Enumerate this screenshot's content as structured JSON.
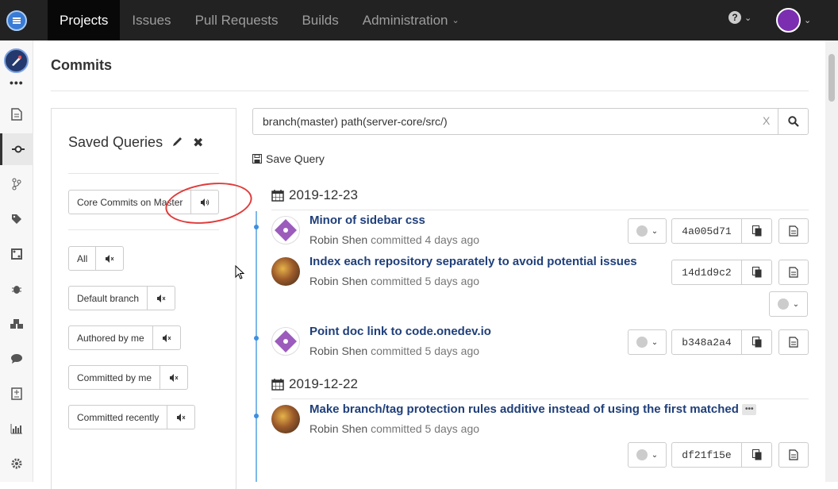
{
  "topnav": {
    "items": [
      {
        "label": "Projects",
        "active": true
      },
      {
        "label": "Issues"
      },
      {
        "label": "Pull Requests"
      },
      {
        "label": "Builds"
      },
      {
        "label": "Administration"
      }
    ],
    "help_icon": "question-circle-icon"
  },
  "page": {
    "title": "Commits"
  },
  "saved_queries": {
    "title": "Saved Queries",
    "items": [
      {
        "label": "Core Commits on Master",
        "watch": "speaker-on-icon"
      },
      {
        "label": "All",
        "watch": "speaker-mute-icon"
      },
      {
        "label": "Default branch",
        "watch": "speaker-mute-icon"
      },
      {
        "label": "Authored by me",
        "watch": "speaker-mute-icon"
      },
      {
        "label": "Committed by me",
        "watch": "speaker-mute-icon"
      },
      {
        "label": "Committed recently",
        "watch": "speaker-mute-icon"
      }
    ]
  },
  "search": {
    "query": "branch(master) path(server-core/src/)",
    "clear": "X",
    "save_label": "Save Query"
  },
  "commits": {
    "dates": [
      "2019-12-23",
      "2019-12-22"
    ],
    "items": [
      {
        "title": "Minor of sidebar css",
        "author": "Robin Shen",
        "when": "committed 4 days ago",
        "hash": "4a005d71"
      },
      {
        "title": "Index each repository separately to avoid potential issues",
        "author": "Robin Shen",
        "when": "committed 5 days ago",
        "hash": "14d1d9c2"
      },
      {
        "title": "Point doc link to code.onedev.io",
        "author": "Robin Shen",
        "when": "committed 5 days ago",
        "hash": "b348a2a4"
      },
      {
        "title": "Make branch/tag protection rules additive instead of using the first matched",
        "author": "Robin Shen",
        "when": "committed 5 days ago",
        "hash": "df21f15e"
      }
    ]
  },
  "colors": {
    "nav_bg": "#222222",
    "link": "#1f3f7a",
    "timeline": "#7fb7e8",
    "highlight": "#e03c3c"
  }
}
